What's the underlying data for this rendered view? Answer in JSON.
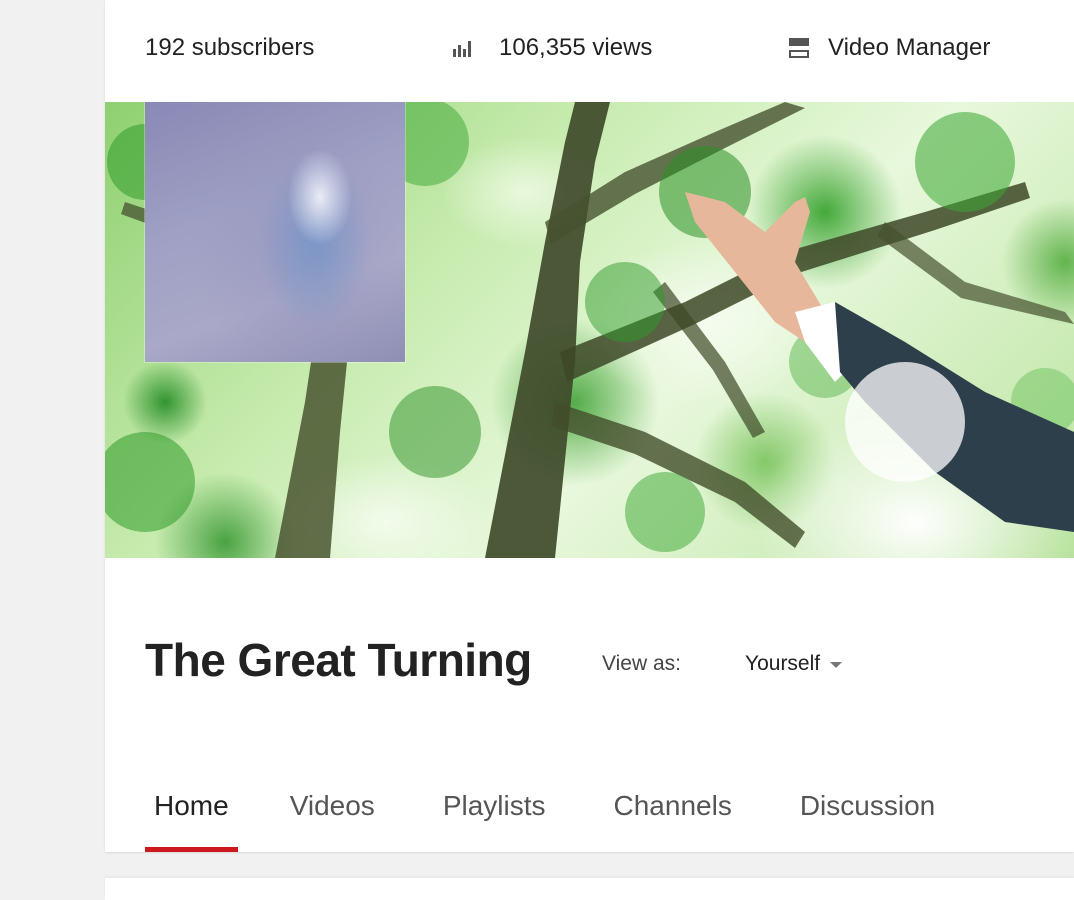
{
  "stats": {
    "subscribers": "192 subscribers",
    "views": "106,355 views",
    "video_manager": "Video Manager"
  },
  "channel": {
    "title": "The Great Turning",
    "view_as_label": "View as:",
    "view_as_value": "Yourself"
  },
  "tabs": [
    {
      "label": "Home",
      "active": true
    },
    {
      "label": "Videos",
      "active": false
    },
    {
      "label": "Playlists",
      "active": false
    },
    {
      "label": "Channels",
      "active": false
    },
    {
      "label": "Discussion",
      "active": false
    }
  ],
  "icons": {
    "views": "bar-chart-icon",
    "video_manager": "video-manager-icon",
    "view_as_dropdown": "caret-down-icon"
  },
  "colors": {
    "active_tab_underline": "#cc181e",
    "page_background": "#f1f1f1",
    "card_background": "#ffffff"
  }
}
